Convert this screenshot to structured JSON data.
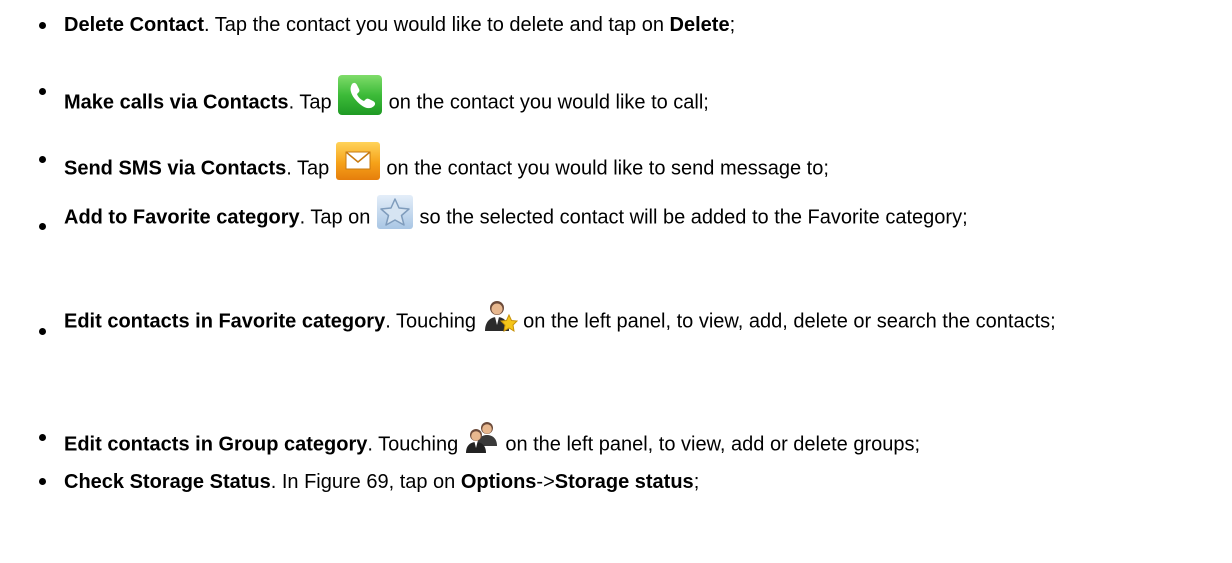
{
  "items": [
    {
      "title": "Delete Contact",
      "t1": ". Tap the contact you would like to delete and tap on ",
      "bold2": "Delete",
      "t2": ";"
    },
    {
      "title": "Make calls via Contacts",
      "t1": ". Tap ",
      "icon": "phone-icon",
      "t2": " on the contact you would like to call;"
    },
    {
      "title": "Send SMS via Contacts",
      "t1": ". Tap ",
      "icon": "envelope-icon",
      "t2": " on the contact you would like to send message to;"
    },
    {
      "title": "Add to Favorite category",
      "t1": ". Tap on ",
      "icon": "star-icon",
      "t2": " so the selected contact will be added to the Favorite category;"
    },
    {
      "title": "Edit contacts in Favorite category",
      "t1": ". Touching ",
      "icon": "favorite-contact-icon",
      "t2": " on the left panel, to view, add, delete or search the contacts;"
    },
    {
      "title": "Edit contacts in Group category",
      "t1": ". Touching ",
      "icon": "group-contacts-icon",
      "t2": " on the left panel, to view, add or delete groups;"
    },
    {
      "title": "Check Storage Status",
      "t1": ". In Figure 69, tap on ",
      "bold2": "Options",
      "t2": "->",
      "bold3": "Storage status",
      "t3": ";"
    }
  ],
  "colors": {
    "phone_green": "#34b536",
    "envelope_orange": "#f6a219",
    "star_blue": "#a9c6e4"
  }
}
